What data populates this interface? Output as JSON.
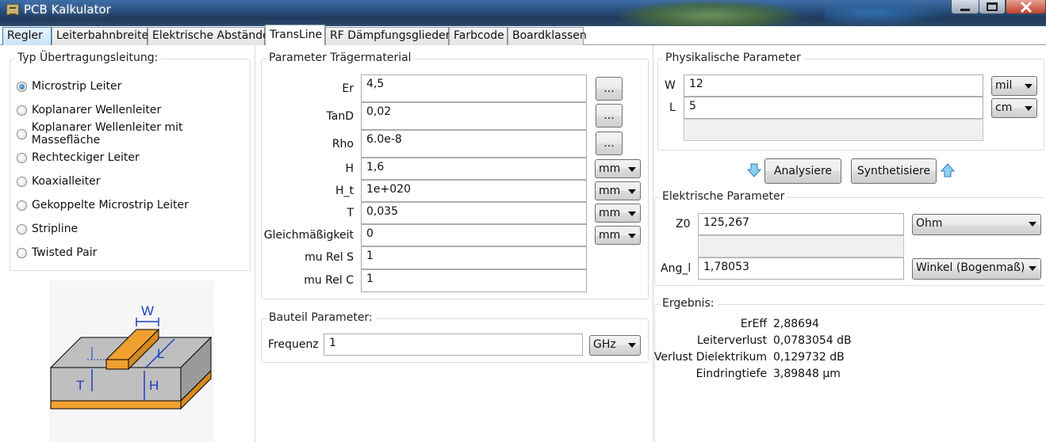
{
  "window": {
    "title": "PCB Kalkulator"
  },
  "tabs": [
    "Regler",
    "Leiterbahnbreite",
    "Elektrische Abstände",
    "TransLine",
    "RF Dämpfungsglieder",
    "Farbcode",
    "Boardklassen"
  ],
  "line_type": {
    "title": "Typ Übertragungsleitung:",
    "options": [
      "Microstrip Leiter",
      "Koplanarer Wellenleiter",
      "Koplanarer Wellenleiter mit Massefläche",
      "Rechteckiger Leiter",
      "Koaxialleiter",
      "Gekoppelte Microstrip Leiter",
      "Stripline",
      "Twisted Pair"
    ],
    "selected": "Microstrip Leiter"
  },
  "diagram": {
    "w": "W",
    "l": "L",
    "t": "T",
    "h": "H"
  },
  "substrate": {
    "title": "Parameter Trägermaterial",
    "rows": [
      {
        "label": "Er",
        "value": "4,5",
        "button": "..."
      },
      {
        "label": "TanD",
        "value": "0,02",
        "button": "..."
      },
      {
        "label": "Rho",
        "value": "6.0e-8",
        "button": "..."
      },
      {
        "label": "H",
        "value": "1,6",
        "unit": "mm"
      },
      {
        "label": "H_t",
        "value": "1e+020",
        "unit": "mm"
      },
      {
        "label": "T",
        "value": "0,035",
        "unit": "mm"
      },
      {
        "label": "Gleichmäßigkeit",
        "value": "0",
        "unit": "mm"
      },
      {
        "label": "mu Rel S",
        "value": "1"
      },
      {
        "label": "mu Rel C",
        "value": "1"
      }
    ]
  },
  "component": {
    "title": "Bauteil Parameter:",
    "freq_label": "Frequenz",
    "freq_value": "1",
    "freq_unit": "GHz"
  },
  "physical": {
    "title": "Physikalische Parameter",
    "w_label": "W",
    "w_value": "12",
    "w_unit": "mil",
    "l_label": "L",
    "l_value": "5",
    "l_unit": "cm",
    "extra_value": ""
  },
  "actions": {
    "analyze": "Analysiere",
    "synthesize": "Synthetisiere"
  },
  "electrical": {
    "title": "Elektrische Parameter",
    "z0_label": "Z0",
    "z0_value": "125,267",
    "z0_unit": "Ohm",
    "extra_value": "",
    "ang_label": "Ang_l",
    "ang_value": "1,78053",
    "ang_unit": "Winkel (Bogenmaß)"
  },
  "results": {
    "title": "Ergebnis:",
    "rows": [
      {
        "key": "ErEff",
        "value": "2,88694"
      },
      {
        "key": "Leiterverlust",
        "value": "0,0783054 dB"
      },
      {
        "key": "Verlust Dielektrikum",
        "value": "0,129732 dB"
      },
      {
        "key": "Eindringtiefe",
        "value": "3,89848 µm"
      }
    ]
  }
}
